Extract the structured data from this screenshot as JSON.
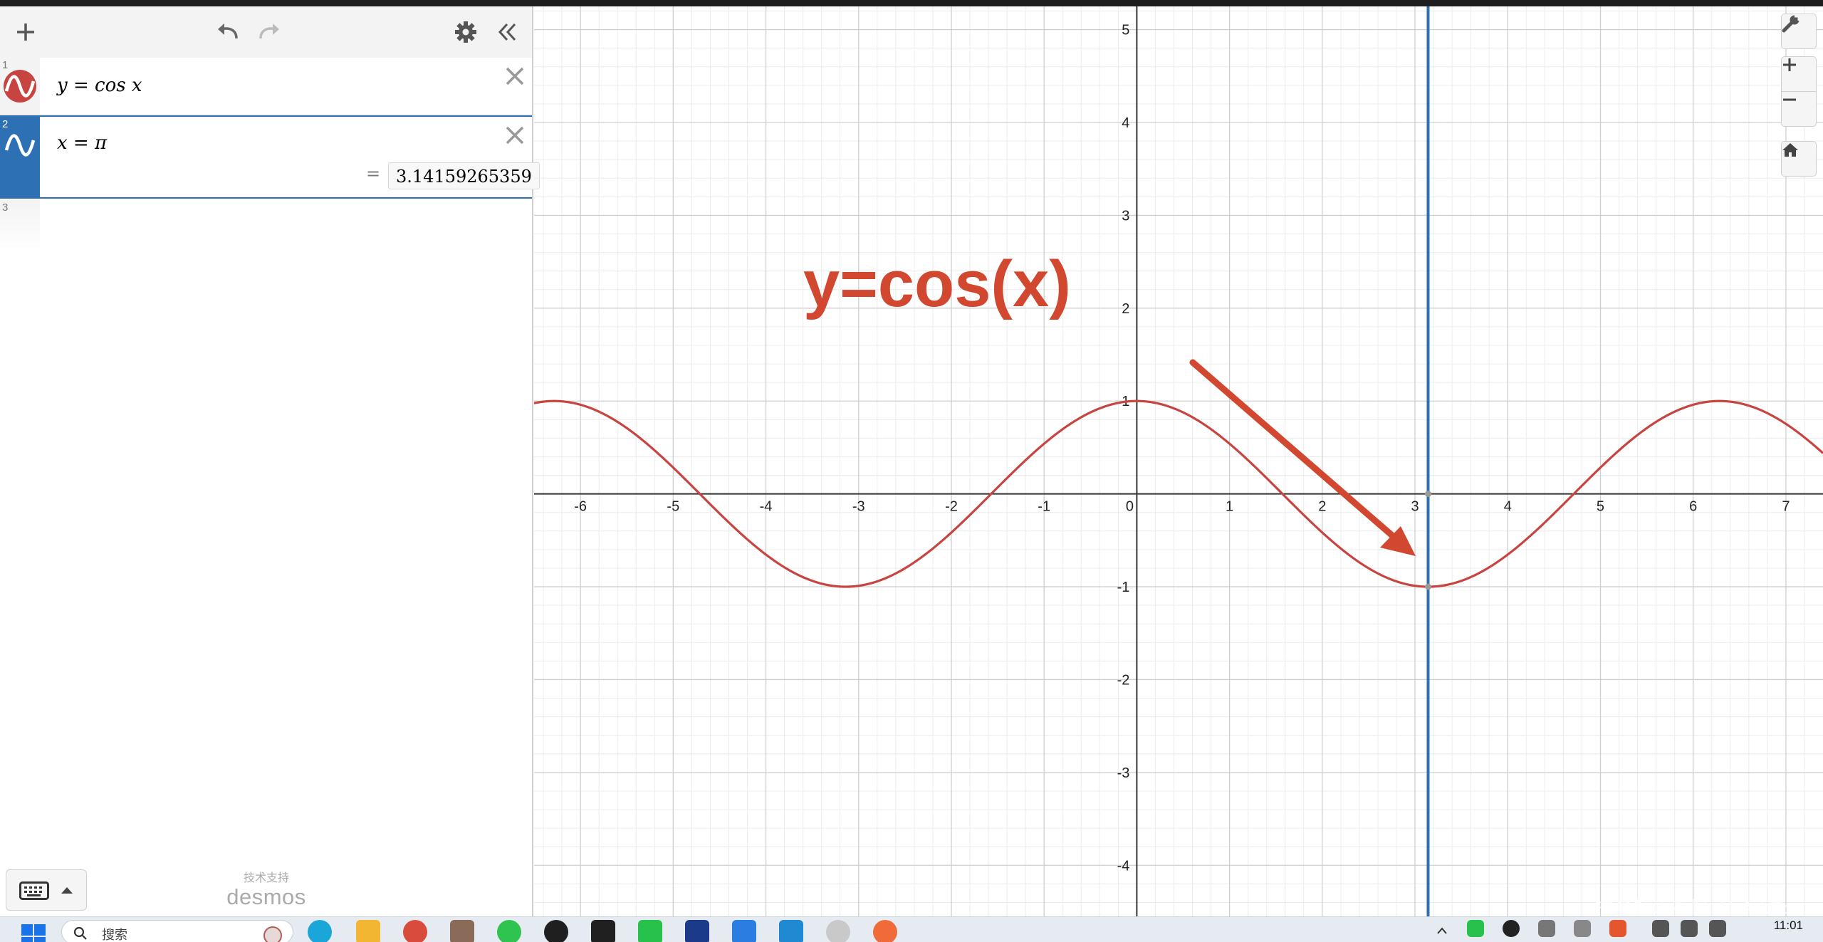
{
  "toolbar": {
    "add_icon": "plus-icon",
    "undo_icon": "undo-icon",
    "redo_icon": "redo-icon",
    "settings_icon": "gear-icon",
    "collapse_icon": "double-chevron-left-icon"
  },
  "expressions": [
    {
      "number": "1",
      "latex": "y = cos x",
      "color": "#c74440"
    },
    {
      "number": "2",
      "latex": "x = π",
      "color": "#2d70b3",
      "eval_eq": "=",
      "eval_value": "3.14159265359"
    },
    {
      "number": "3"
    }
  ],
  "footer": {
    "powered_by": "技术支持",
    "brand": "desmos",
    "keyboard_icon": "keyboard-icon"
  },
  "graph_controls": [
    "wrench-icon",
    "zoom-in-icon",
    "zoom-out-icon",
    "home-icon"
  ],
  "annotation": {
    "text": "y=cos(x)",
    "color": "#d2472f"
  },
  "watermark": "掘金技术社区 @ ArkPppp",
  "taskbar": {
    "search_placeholder": "搜索",
    "time": "11:01"
  },
  "chart_data": {
    "type": "line",
    "title": "",
    "xlabel": "",
    "ylabel": "",
    "xlim": [
      -6.5,
      7.4
    ],
    "ylim": [
      -4.55,
      5.25
    ],
    "xticks": [
      -6,
      -5,
      -4,
      -3,
      -2,
      -1,
      0,
      1,
      2,
      3,
      4,
      5,
      6,
      7
    ],
    "yticks": [
      -4,
      -3,
      -2,
      -1,
      1,
      2,
      3,
      4,
      5
    ],
    "grid": true,
    "series": [
      {
        "name": "",
        "equation": "y = cos x",
        "color": "#c74440"
      },
      {
        "name": "",
        "equation": "x = π",
        "x": 3.14159265359,
        "color": "#2d70b3"
      }
    ],
    "points": [
      {
        "x": 3.14159265359,
        "y": 0
      },
      {
        "x": 3.14159265359,
        "y": -1
      }
    ]
  }
}
